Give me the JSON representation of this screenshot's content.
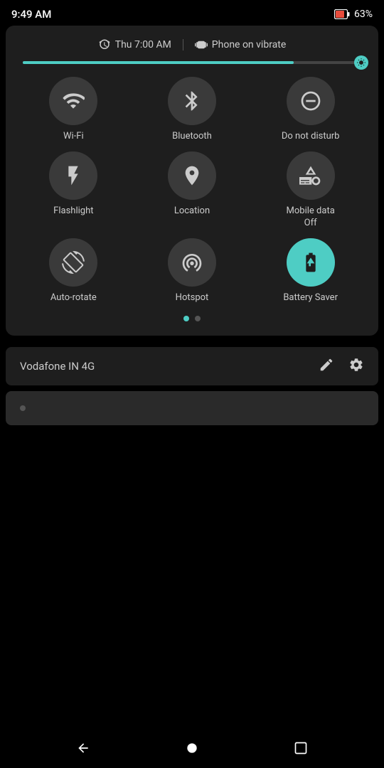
{
  "status": {
    "time": "9:49 AM",
    "battery_pct": "63%"
  },
  "alarm": {
    "icon": "⏰",
    "label": "Thu 7:00 AM",
    "vibrate_label": "Phone on vibrate"
  },
  "brightness": {
    "fill_percent": 80
  },
  "tiles": [
    {
      "id": "wifi",
      "label": "Wi-Fi",
      "active": false
    },
    {
      "id": "bluetooth",
      "label": "Bluetooth",
      "active": false
    },
    {
      "id": "dnd",
      "label": "Do not disturb",
      "active": false
    },
    {
      "id": "flashlight",
      "label": "Flashlight",
      "active": false
    },
    {
      "id": "location",
      "label": "Location",
      "active": false
    },
    {
      "id": "mobiledata",
      "label": "Mobile data\nOff",
      "active": false
    },
    {
      "id": "autorotate",
      "label": "Auto-rotate",
      "active": false
    },
    {
      "id": "hotspot",
      "label": "Hotspot",
      "active": false
    },
    {
      "id": "batterysaver",
      "label": "Battery Saver",
      "active": true
    }
  ],
  "page_dots": [
    {
      "active": true
    },
    {
      "active": false
    }
  ],
  "footer": {
    "carrier": "Vodafone IN 4G"
  },
  "nav": {
    "back_label": "◀",
    "home_label": "●",
    "recents_label": "■"
  }
}
